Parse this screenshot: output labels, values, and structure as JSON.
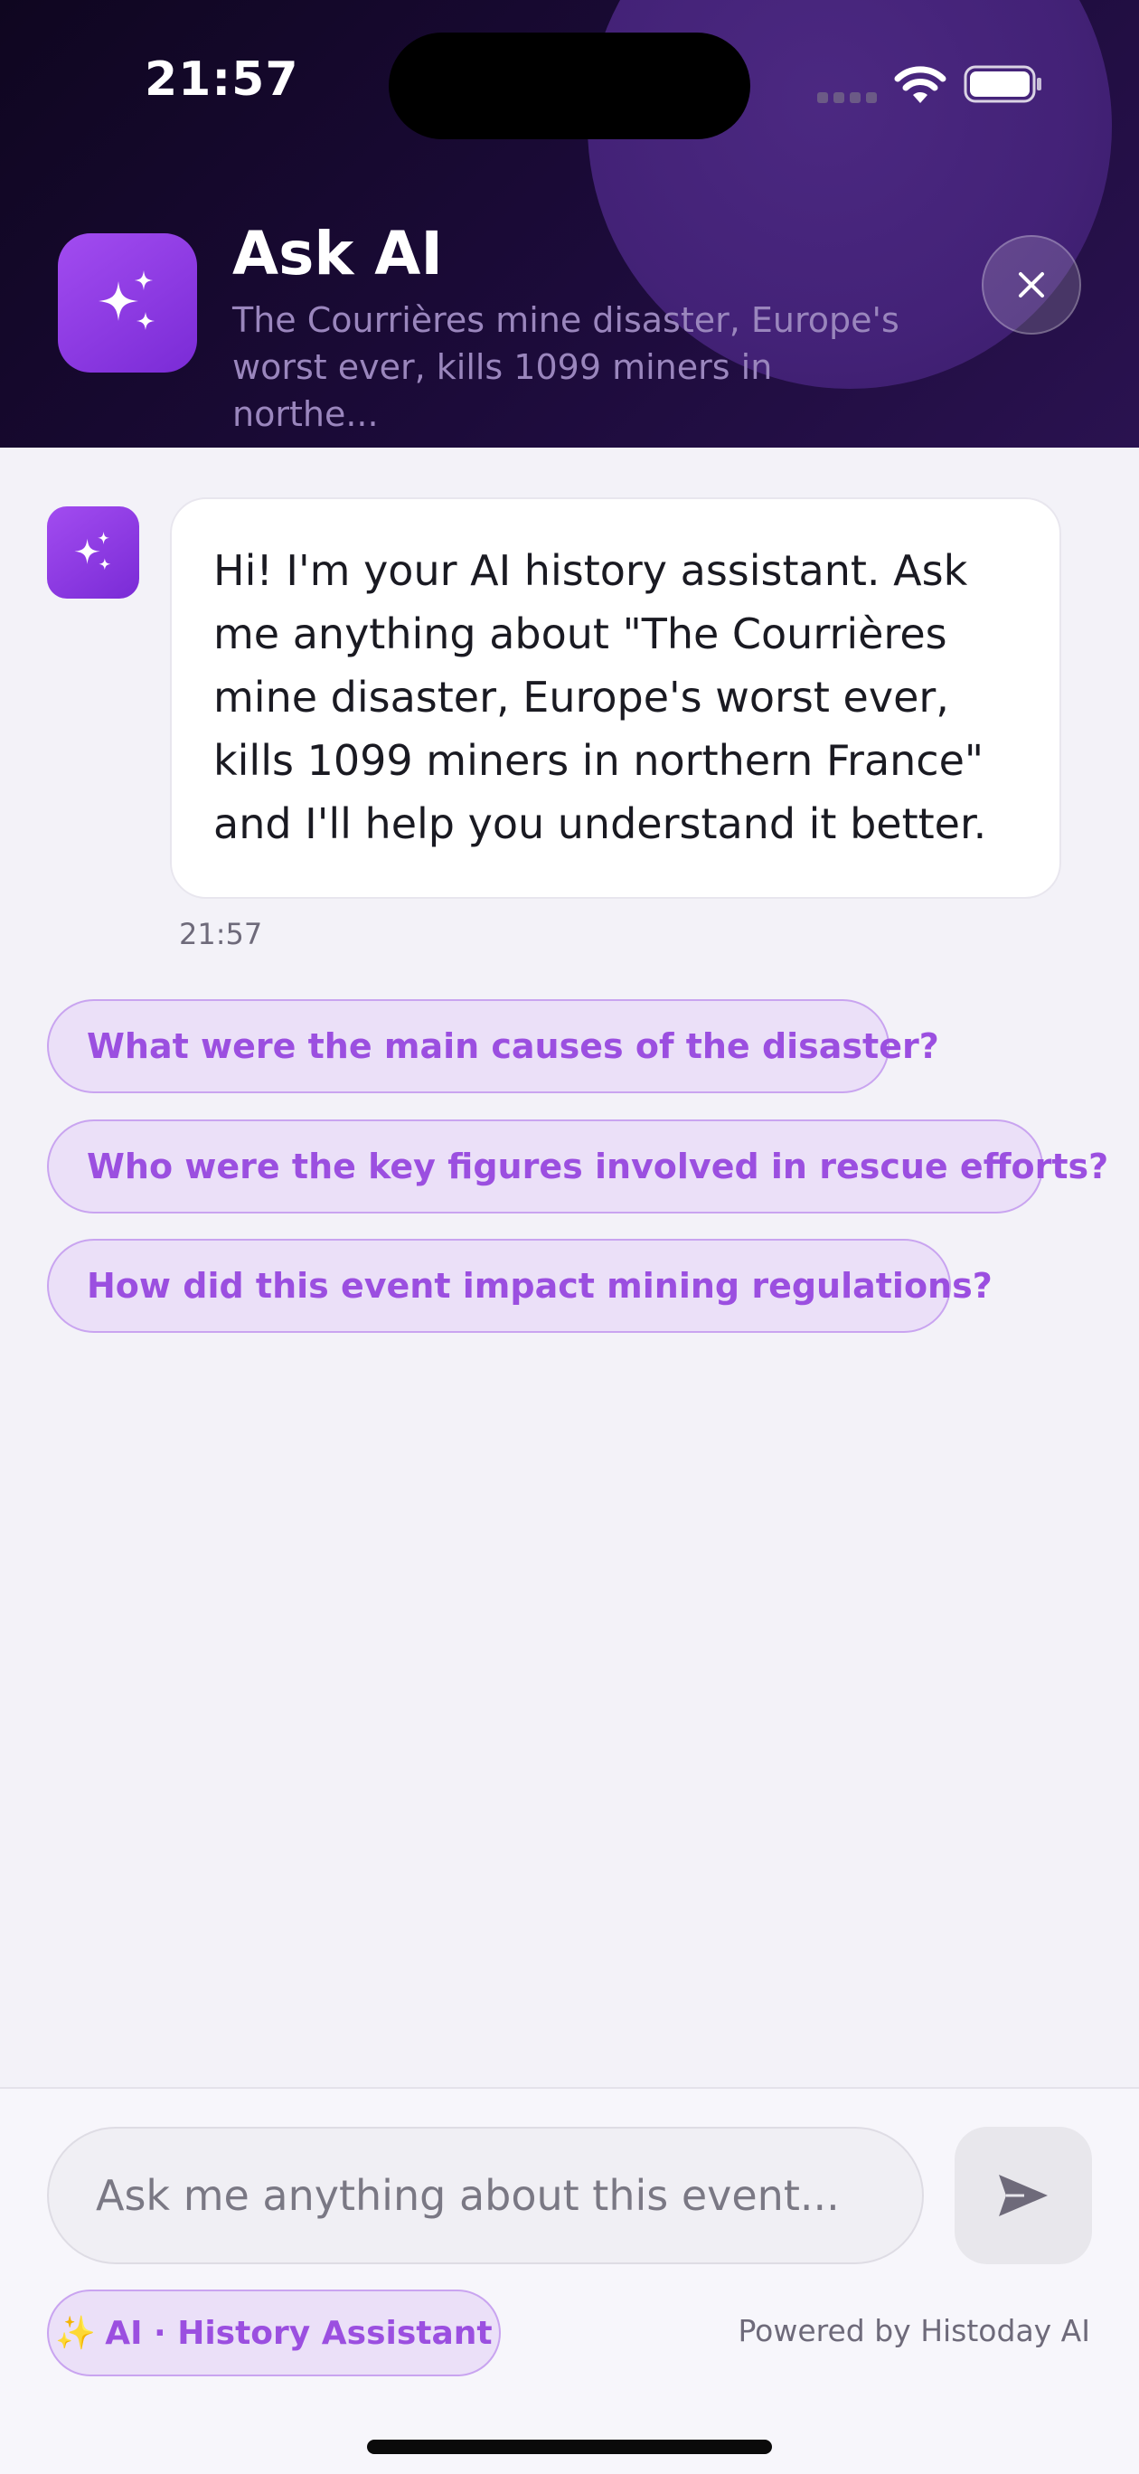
{
  "status_bar": {
    "time": "21:57"
  },
  "header": {
    "title": "Ask AI",
    "subtitle": "The Courrières mine disaster, Europe's worst ever, kills 1099 miners in northe...",
    "app_icon": "sparkles-icon",
    "close_icon": "close-icon"
  },
  "chat": {
    "messages": [
      {
        "role": "assistant",
        "text": "Hi! I'm your AI history assistant. Ask me anything about \"The Courrières mine disaster, Europe's worst ever, kills 1099 miners in northern France\" and I'll help you understand it better.",
        "time": "21:57"
      }
    ],
    "suggestions": [
      "What were the main causes of the disaster?",
      "Who were the key figures involved in rescue efforts?",
      "How did this event impact mining regulations?"
    ]
  },
  "composer": {
    "placeholder": "Ask me anything about this event...",
    "value": "",
    "send_icon": "send-icon"
  },
  "footer": {
    "badge_emoji": "✨",
    "badge_label": "AI · History Assistant",
    "powered_by": "Powered by Histoday AI"
  },
  "colors": {
    "accent": "#9b4fe0",
    "header_bg": "#1c0b3a",
    "chip_bg": "#ebe0f8"
  }
}
